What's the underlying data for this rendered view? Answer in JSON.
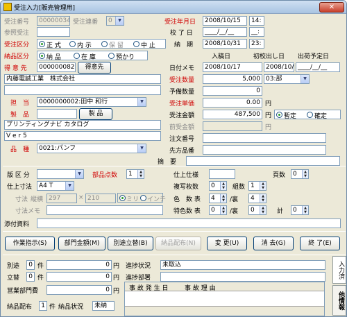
{
  "window": {
    "title": "受注入力[販売管理用]",
    "close": "✕"
  },
  "top": {
    "order_no_label": "受注番号",
    "order_no_value": "00000034",
    "order_seq_label": "受注連番",
    "order_seq_value": "0",
    "ref_order_label": "参照受注",
    "ref_order_value": "",
    "order_date_label": "受注年月日",
    "order_date_value": "2008/10/15",
    "order_time_value": "14:",
    "close_date_label": "校 了 日",
    "close_date_value": "____/__/__",
    "close_time_value": "__:",
    "order_type_label": "受注区分",
    "order_type_options": [
      "正 式",
      "内 示",
      "保 留",
      "中 止"
    ],
    "delivery_label": "納　期",
    "delivery_date_value": "2008/10/31",
    "delivery_time_value": "23:",
    "ship_type_label": "納品区分",
    "ship_type_options": [
      "納 品",
      "在 庫",
      "預かり"
    ]
  },
  "customer": {
    "label": "得 意 先",
    "code": "0000000820",
    "button": "得意先",
    "name": "内藤電誠工業　株式会社",
    "name2": "",
    "staff_label": "担　当",
    "staff_value": "0000000002:田中 和行",
    "product_label": "製　品",
    "product_code": "",
    "product_button": "製 品",
    "product_name": "プリンティングナビ カタログ",
    "product_vol": "V e r 5",
    "kind_label": "品　種",
    "kind_value": "0021:パンフ"
  },
  "dates": {
    "memo_label": "日付メモ",
    "in_date_label": "入稿日",
    "in_date_value": "2008/10/17",
    "first_ship_label": "初校出し日",
    "first_ship_value": "2008/10/22",
    "ship_plan_label": "出荷予定日",
    "ship_plan_value": "____/__/__"
  },
  "amounts": {
    "qty_label": "受注数量",
    "qty_value": "5,000",
    "unit_value": "03:部",
    "spare_label": "予備数量",
    "spare_value": "0",
    "price_label": "受注単価",
    "price_value": "0.00",
    "price_unit": "円",
    "total_label": "受注金額",
    "total_value": "487,500",
    "total_unit": "円",
    "status_options": [
      "暫定",
      "確定"
    ],
    "prev_label": "前受金額",
    "prev_value": "",
    "prev_unit": "円",
    "note_no_label": "注文番号",
    "note_no_value": "",
    "cust_item_label": "先方品番",
    "cust_item_value": "",
    "summary_label": "摘　要",
    "summary_value": ""
  },
  "spec": {
    "edition_label": "版 区 分",
    "edition_value": "",
    "parts_label": "部品点数",
    "parts_value": "1",
    "finish_label": "仕上仕様",
    "finish_value": "",
    "pages_label": "頁数",
    "pages_value": "0",
    "finish_size_label": "仕上寸法",
    "finish_size_value": "A4 T",
    "copy_label": "複写枚数",
    "copy_value": "0",
    "set_label": "組数",
    "set_value": "1",
    "size_label": "寸法",
    "size_vert_label": "縦横",
    "size_w": "297",
    "size_x": "×",
    "size_h": "210",
    "mm_label": "ミリ",
    "inch_label": "インチ",
    "colors_label": "色　数 表",
    "colors_front": "4",
    "colors_back_label": "/裏",
    "colors_back": "4",
    "size_memo_label": "寸法メモ",
    "size_memo_value": "",
    "special_label": "特色数 表",
    "special_front": "0",
    "special_back_label": "/裏",
    "special_back": "0",
    "total_label": "計",
    "total_value": "0",
    "attach_label": "添付資料",
    "attach_value": ""
  },
  "buttons": {
    "work": "作業指示(S)",
    "dept": "部門金額(M)",
    "sub": "別途立替(B)",
    "distrib": "納品配布(N)",
    "change": "変 更(U)",
    "cancel": "消 去(G)",
    "end": "終 了(E)"
  },
  "bottom": {
    "extra_label": "別途",
    "extra_count": "0",
    "extra_unit": "件",
    "extra_amount": "0",
    "yen": "円",
    "adv_label": "立替",
    "adv_count": "0",
    "adv_unit": "件",
    "adv_amount": "0",
    "sales_dept_label": "営業部門費",
    "sales_dept_amount": "0",
    "distrib_label": "納品配布",
    "distrib_count": "1",
    "distrib_unit": "件",
    "distrib_status_label": "納品状況",
    "distrib_status": "未納",
    "progress_label": "進捗状況",
    "progress_value": "未取込",
    "progress_dept_label": "進捗部署",
    "progress_dept_value": "",
    "grid_headers": [
      "事 故 発 生 日",
      "事 故 理 由"
    ],
    "tabs": [
      "入力済",
      "他情報"
    ]
  }
}
